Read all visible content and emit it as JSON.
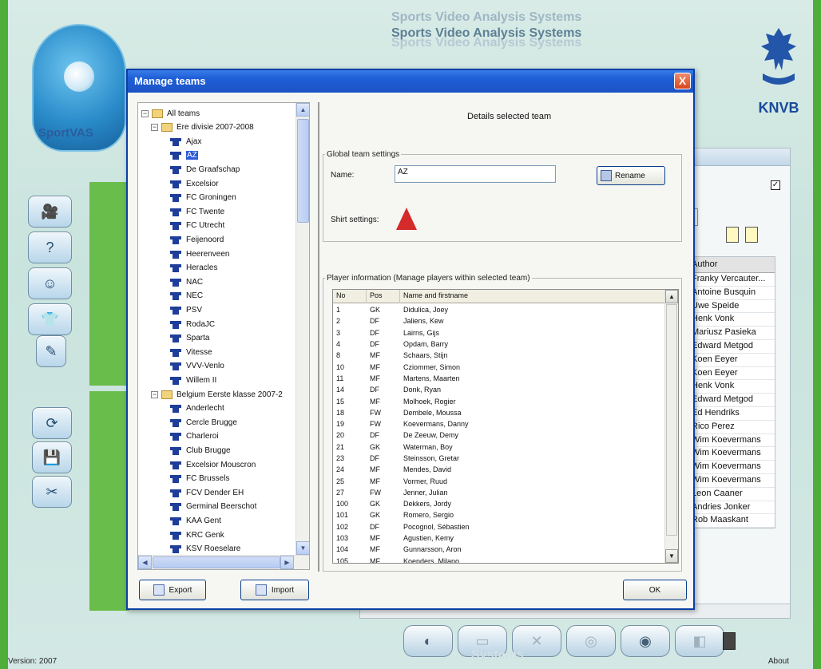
{
  "app": {
    "title_lines": [
      "Sports Video Analysis Systems",
      "Sports Video Analysis Systems",
      "Sports Video Analysis Systems"
    ],
    "logo_text": "SportVAS",
    "knvb_text": "KNVB",
    "version": "Version: 2007",
    "about": "About"
  },
  "side_buttons": [
    "video-camera-icon",
    "stats-icon",
    "face-icon",
    "shirts-icon",
    "notes-icon",
    "sync-icon",
    "disk-icon",
    "tools-icon"
  ],
  "main_panel": {
    "checkbox_mark": "✓",
    "author_header": "Author",
    "authors": [
      "Franky Vercauter...",
      "Antoine Busquin",
      "Uwe Speide",
      "Henk Vonk",
      "Mariusz Pasieka",
      "Edward Metgod",
      "Koen Eeyer",
      "Koen Eeyer",
      "Henk Vonk",
      "Edward Metgod",
      "Ed Hendriks",
      "Rico Perez",
      "Wim Koevermans",
      "Wim Koevermans",
      "Wim Koevermans",
      "Wim Koevermans",
      "Leon Caaner",
      "Andries Jonker",
      "Rob Maaskant"
    ]
  },
  "dialog": {
    "title": "Manage teams",
    "close_label": "X",
    "details_title": "Details selected team",
    "global_legend": "Global team settings",
    "name_label": "Name:",
    "name_value": "AZ",
    "rename_label": "Rename",
    "shirt_label": "Shirt settings:",
    "player_legend": "Player information (Manage players within selected team)",
    "export_label": "Export",
    "import_label": "Import",
    "ok_label": "OK",
    "tree": {
      "root": "All teams",
      "groups": [
        {
          "name": "Ere divisie 2007-2008",
          "teams": [
            "Ajax",
            "AZ",
            "De Graafschap",
            "Excelsior",
            "FC Groningen",
            "FC Twente",
            "FC Utrecht",
            "Feijenoord",
            "Heerenveen",
            "Heracles",
            "NAC",
            "NEC",
            "PSV",
            "RodaJC",
            "Sparta",
            "Vitesse",
            "VVV-Venlo",
            "Willem II"
          ]
        },
        {
          "name": "Belgium Eerste klasse 2007-2",
          "teams": [
            "Anderlecht",
            "Cercle Brugge",
            "Charleroi",
            "Club Brugge",
            "Excelsior Mouscron",
            "FC Brussels",
            "FCV Dender EH",
            "Germinal Beerschot",
            "KAA Gent",
            "KRC Genk",
            "KSV Roeselare"
          ]
        }
      ],
      "selected": "AZ"
    },
    "players": {
      "columns": [
        "No",
        "Pos",
        "Name and firstname"
      ],
      "rows": [
        [
          "1",
          "GK",
          "Didulica, Joey"
        ],
        [
          "2",
          "DF",
          "Jaliens, Kew"
        ],
        [
          "3",
          "DF",
          "Lairns, Gijs"
        ],
        [
          "4",
          "DF",
          "Opdam, Barry"
        ],
        [
          "8",
          "MF",
          "Schaars, Stijn"
        ],
        [
          "10",
          "MF",
          "Cziommer, Simon"
        ],
        [
          "11",
          "MF",
          "Martens, Maarten"
        ],
        [
          "14",
          "DF",
          "Donk, Ryan"
        ],
        [
          "15",
          "MF",
          "Molhoek, Rogier"
        ],
        [
          "18",
          "FW",
          "Dembele, Moussa"
        ],
        [
          "19",
          "FW",
          "Koevermans, Danny"
        ],
        [
          "20",
          "DF",
          "De Zeeuw, Demy"
        ],
        [
          "21",
          "GK",
          "Waterman, Boy"
        ],
        [
          "23",
          "DF",
          "Steinsson, Gretar"
        ],
        [
          "24",
          "MF",
          "Mendes, David"
        ],
        [
          "25",
          "MF",
          "Vormer, Ruud"
        ],
        [
          "27",
          "FW",
          "Jenner, Julian"
        ],
        [
          "100",
          "GK",
          "Dekkers, Jordy"
        ],
        [
          "101",
          "GK",
          "Romero, Sergio"
        ],
        [
          "102",
          "DF",
          "Pocognol, Sébastien"
        ],
        [
          "103",
          "MF",
          "Agustien, Kemy"
        ],
        [
          "104",
          "MF",
          "Gunnarsson, Aron"
        ],
        [
          "105",
          "MF",
          "Koenders, Milano"
        ]
      ]
    }
  },
  "bottom_toolbar": [
    "new-analysis-icon",
    "open-folder-icon",
    "delete-icon",
    "record-icon",
    "camera-icon",
    "save-icon"
  ]
}
